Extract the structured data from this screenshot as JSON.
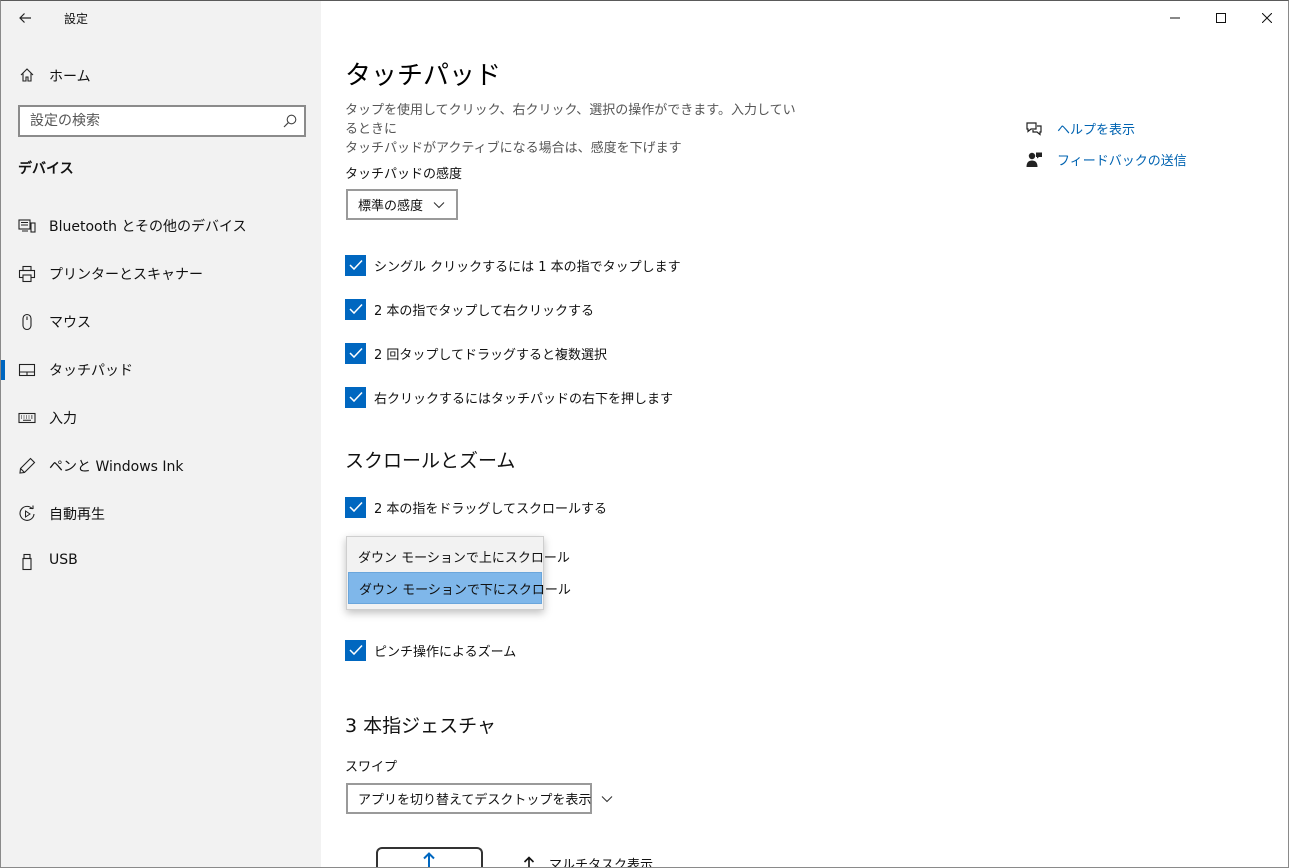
{
  "window": {
    "app_title": "設定"
  },
  "sidebar": {
    "home_label": "ホーム",
    "search_placeholder": "設定の検索",
    "section_title": "デバイス",
    "items": [
      {
        "label": "Bluetooth とその他のデバイス",
        "icon": "bluetooth-devices-icon",
        "selected": false
      },
      {
        "label": "プリンターとスキャナー",
        "icon": "printer-icon",
        "selected": false
      },
      {
        "label": "マウス",
        "icon": "mouse-icon",
        "selected": false
      },
      {
        "label": "タッチパッド",
        "icon": "touchpad-icon",
        "selected": true
      },
      {
        "label": "入力",
        "icon": "keyboard-icon",
        "selected": false
      },
      {
        "label": "ペンと Windows Ink",
        "icon": "pen-icon",
        "selected": false
      },
      {
        "label": "自動再生",
        "icon": "autoplay-icon",
        "selected": false
      },
      {
        "label": "USB",
        "icon": "usb-icon",
        "selected": false
      }
    ]
  },
  "main": {
    "title": "タッチパッド",
    "description_line1": "タップを使用してクリック、右クリック、選択の操作ができます。入力しているときに",
    "description_line2": "タッチパッドがアクティブになる場合は、感度を下げます",
    "sensitivity": {
      "label": "タッチパッドの感度",
      "value": "標準の感度"
    },
    "tap_options": [
      {
        "label": "シングル クリックするには 1 本の指でタップします",
        "checked": true
      },
      {
        "label": "2 本の指でタップして右クリックする",
        "checked": true
      },
      {
        "label": "2 回タップしてドラッグすると複数選択",
        "checked": true
      },
      {
        "label": "右クリックするにはタッチパッドの右下を押します",
        "checked": true
      }
    ],
    "scroll_zoom": {
      "heading": "スクロールとズーム",
      "drag_scroll_label": "2 本の指をドラッグしてスクロールする",
      "drag_scroll_checked": true,
      "scroll_direction_options": [
        {
          "label": "ダウン モーションで上にスクロール",
          "selected": false
        },
        {
          "label": "ダウン モーションで下にスクロール",
          "selected": true
        }
      ],
      "pinch_zoom_label": "ピンチ操作によるズーム",
      "pinch_zoom_checked": true
    },
    "three_finger": {
      "heading": "3 本指ジェスチャ",
      "swipe_label": "スワイプ",
      "swipe_value": "アプリを切り替えてデスクトップを表示",
      "gesture_up_label": "マルチタスク表示"
    }
  },
  "help": {
    "show_help": "ヘルプを表示",
    "send_feedback": "フィードバックの送信"
  },
  "colors": {
    "accent": "#0067c0",
    "link": "#0063b1",
    "sidebar_bg": "#f2f2f2",
    "dropdown_selected": "#7fb7ea"
  }
}
